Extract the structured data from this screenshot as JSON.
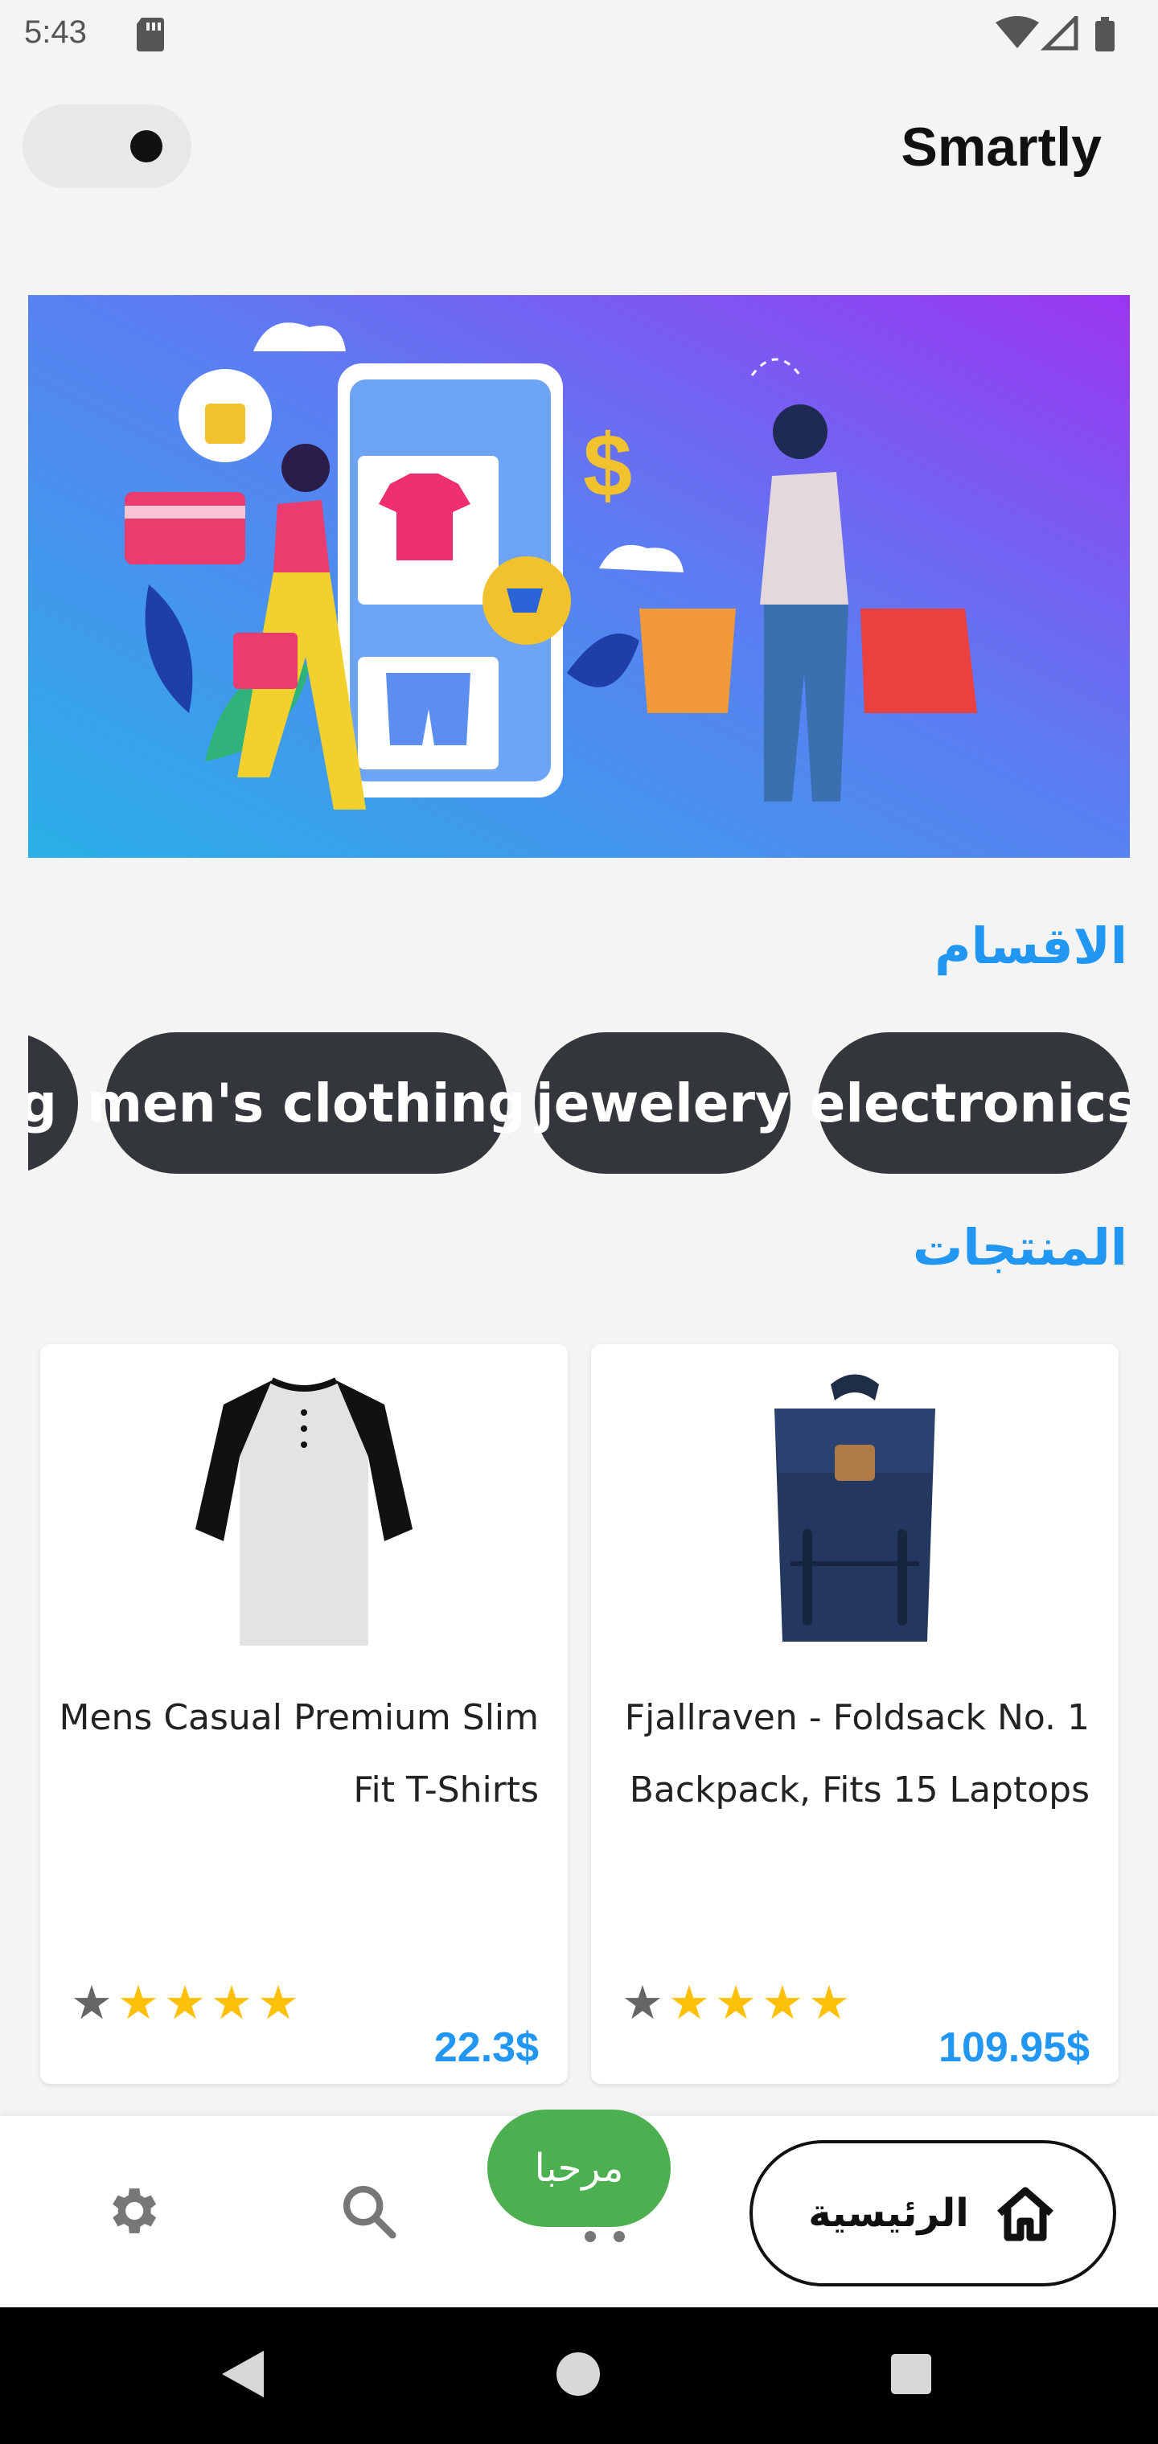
{
  "status_bar": {
    "time": "5:43",
    "icons": [
      "sd-card-icon",
      "wifi-icon",
      "signal-icon",
      "battery-icon"
    ]
  },
  "app_bar": {
    "title": "Smartly",
    "theme_toggle_icon": "toggle-icon"
  },
  "banner": {
    "icon": "shopping-illustration"
  },
  "categories": {
    "title": "الاقسام",
    "items": [
      "electronics",
      "jewelery",
      "men's clothing",
      "g"
    ]
  },
  "products": {
    "title": "المنتجات",
    "items": [
      {
        "title": "Fjallraven - Foldsack No. 1 Backpack, Fits 15 Laptops",
        "price": "109.95$",
        "rating_stars": 5,
        "image_icon": "backpack-image"
      },
      {
        "title": "Mens Casual Premium Slim Fit T-Shirts",
        "price": "22.3$",
        "rating_stars": 5,
        "image_icon": "tshirt-image"
      }
    ]
  },
  "bottom_nav": {
    "home_label": "الرئيسية",
    "welcome_label": "مرحبا",
    "icons": [
      "home-icon",
      "dots-icon",
      "search-icon",
      "gear-icon"
    ]
  },
  "colors": {
    "accent": "#2196f3",
    "chip_bg": "#33363a",
    "welcome_bg": "#4caf50",
    "star": "#ffc107"
  }
}
